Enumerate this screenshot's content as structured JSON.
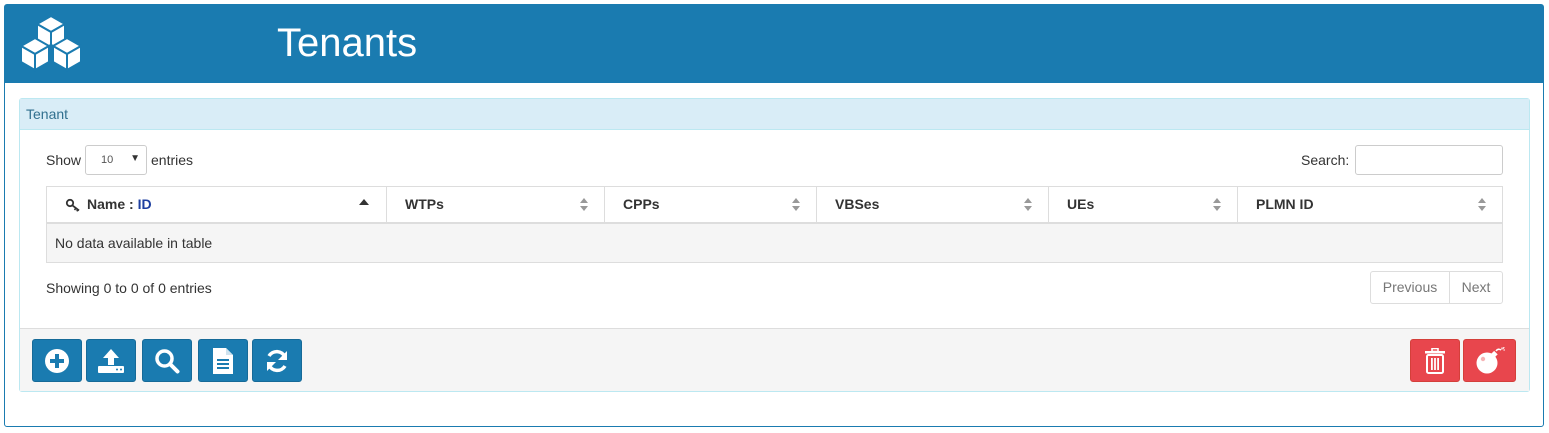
{
  "header": {
    "title": "Tenants",
    "logo_icon": "cubes-icon",
    "bg_color": "#1a7bb0"
  },
  "panel": {
    "heading": "Tenant"
  },
  "length_control": {
    "show_label": "Show",
    "selected": "10",
    "entries_label": "entries"
  },
  "search": {
    "label": "Search:",
    "value": ""
  },
  "table": {
    "columns": [
      {
        "name_part": "Name : ",
        "id_part": "ID",
        "sort": "ascending",
        "icon": "key-icon"
      },
      {
        "label": "WTPs",
        "sort": "both"
      },
      {
        "label": "CPPs",
        "sort": "both"
      },
      {
        "label": "VBSes",
        "sort": "both"
      },
      {
        "label": "UEs",
        "sort": "both"
      },
      {
        "label": "PLMN ID",
        "sort": "both"
      }
    ],
    "empty_message": "No data available in table"
  },
  "info": "Showing 0 to 0 of 0 entries",
  "pagination": {
    "previous": "Previous",
    "next": "Next"
  },
  "footer": {
    "left_buttons": [
      "add-icon",
      "upload-icon",
      "search-icon",
      "document-icon",
      "refresh-icon"
    ],
    "right_buttons": [
      "trash-icon",
      "bomb-icon"
    ],
    "accent": "#1a7bb0",
    "danger": "#e8464d"
  }
}
